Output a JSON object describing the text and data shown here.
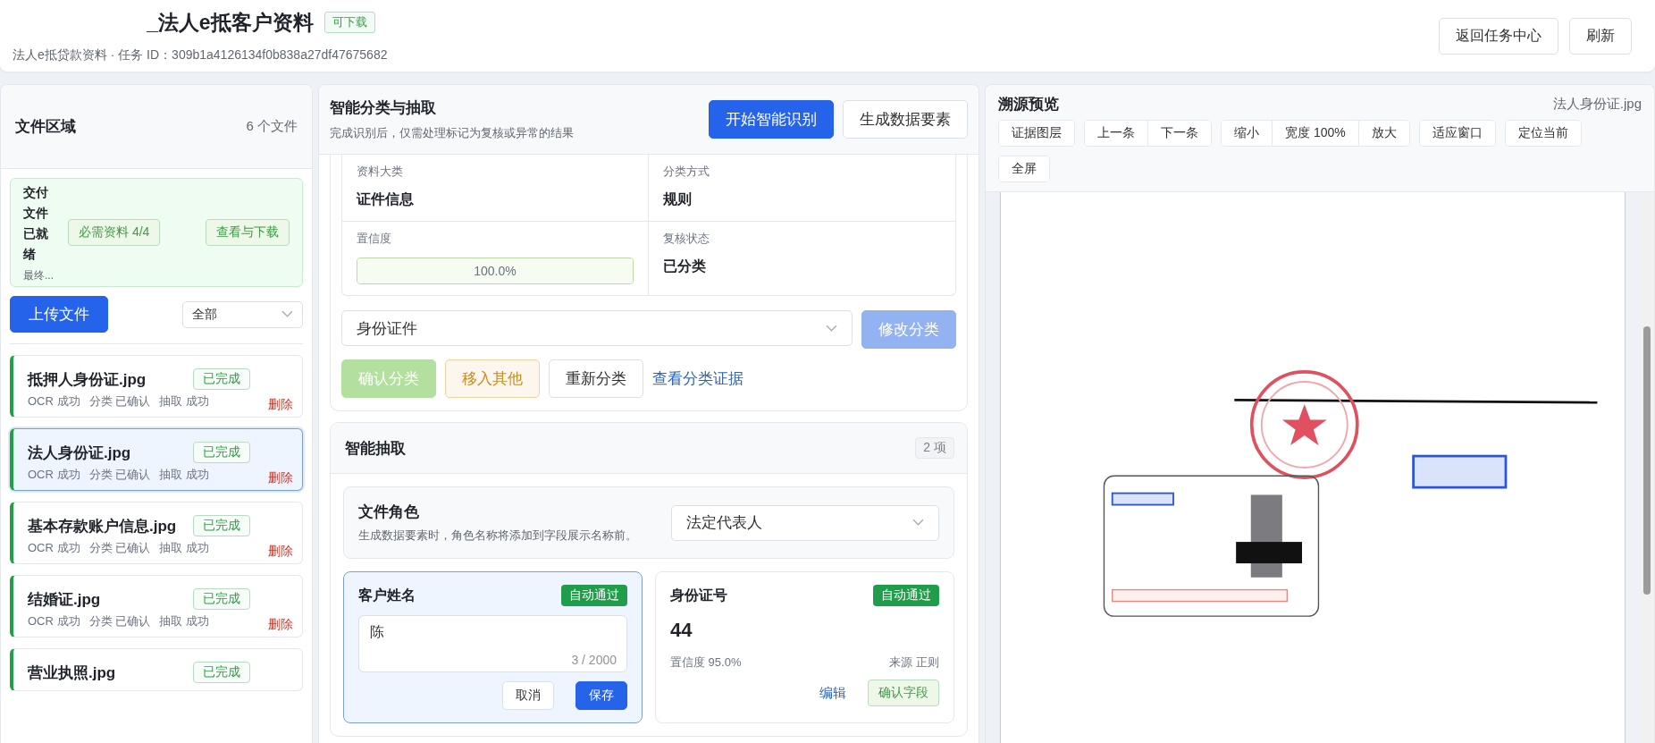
{
  "header": {
    "title": "_法人e抵客户资料",
    "badge": "可下载",
    "subtitle": "法人e抵贷款资料 · 任务 ID：309b1a4126134f0b838a27df47675682",
    "buttons": [
      "返回任务中心",
      "刷新"
    ]
  },
  "files_panel": {
    "title": "文件区域",
    "count": "6 个文件",
    "delivery": {
      "title": "交付文件已就绪",
      "note": "最终...",
      "required": "必需资料 4/4",
      "action": "查看与下载"
    },
    "upload": "上传文件",
    "filter": "全部",
    "files": [
      {
        "name": "抵押人身份证.jpg",
        "status": "已完成",
        "steps": [
          "OCR 成功",
          "分类 已确认",
          "抽取 成功"
        ],
        "delete": "删除",
        "selected": false
      },
      {
        "name": "法人身份证.jpg",
        "status": "已完成",
        "steps": [
          "OCR 成功",
          "分类 已确认",
          "抽取 成功"
        ],
        "delete": "删除",
        "selected": true
      },
      {
        "name": "基本存款账户信息.jpg",
        "status": "已完成",
        "steps": [
          "OCR 成功",
          "分类 已确认",
          "抽取 成功"
        ],
        "delete": "删除",
        "selected": false
      },
      {
        "name": "结婚证.jpg",
        "status": "已完成",
        "steps": [
          "OCR 成功",
          "分类 已确认",
          "抽取 成功"
        ],
        "delete": "删除",
        "selected": false
      },
      {
        "name": "营业执照.jpg",
        "status": "已完成",
        "selected": false
      }
    ]
  },
  "classify_panel": {
    "title": "智能分类与抽取",
    "subtitle": "完成识别后，仅需处理标记为复核或异常的结果",
    "buttons": [
      {
        "label": "开始智能识别",
        "kind": "primary"
      },
      {
        "label": "生成数据要素",
        "kind": "default"
      }
    ],
    "summary": [
      {
        "label": "资料大类",
        "kind": "text",
        "value": "证件信息"
      },
      {
        "label": "分类方式",
        "kind": "text",
        "value": "规则"
      },
      {
        "label": "置信度",
        "kind": "meter",
        "level": 1,
        "reading": "100.0%"
      },
      {
        "label": "复核状态",
        "kind": "text",
        "value": "已分类"
      }
    ],
    "category_select": "身份证件",
    "modify": {
      "label": "修改分类",
      "disabled": true
    },
    "actions": [
      {
        "label": "确认分类",
        "kind": "success",
        "disabled": true
      },
      {
        "label": "移入其他",
        "kind": "warning",
        "disabled": false
      },
      {
        "label": "重新分类",
        "kind": "default",
        "disabled": false
      },
      {
        "label": "查看分类证据",
        "kind": "link",
        "disabled": false
      }
    ]
  },
  "extract_panel": {
    "title": "智能抽取",
    "count": "2 项",
    "role": {
      "title": "文件角色",
      "hint": "生成数据要素时，角色名称将添加到字段展示名称前。",
      "select": "法定代表人"
    },
    "fields": [
      {
        "kind": "editing",
        "label": "客户姓名",
        "badge": "自动通过",
        "value": "陈",
        "counter": "3 / 2000",
        "buttons": [
          "取消",
          "保存"
        ]
      },
      {
        "kind": "display",
        "label": "身份证号",
        "badge": "自动通过",
        "value": "44",
        "confidence": "置信度 95.0%",
        "source": "来源 正则",
        "edit": "编辑",
        "confirm": "确认字段"
      }
    ]
  },
  "preview_panel": {
    "title": "溯源预览",
    "file": "法人身份证.jpg",
    "toolbar": [
      [
        "证据图层"
      ],
      [
        "上一条",
        "下一条"
      ],
      [
        "缩小",
        "宽度 100%",
        "放大"
      ],
      [
        "适应窗口"
      ],
      [
        "定位当前"
      ],
      [
        "全屏"
      ]
    ]
  }
}
